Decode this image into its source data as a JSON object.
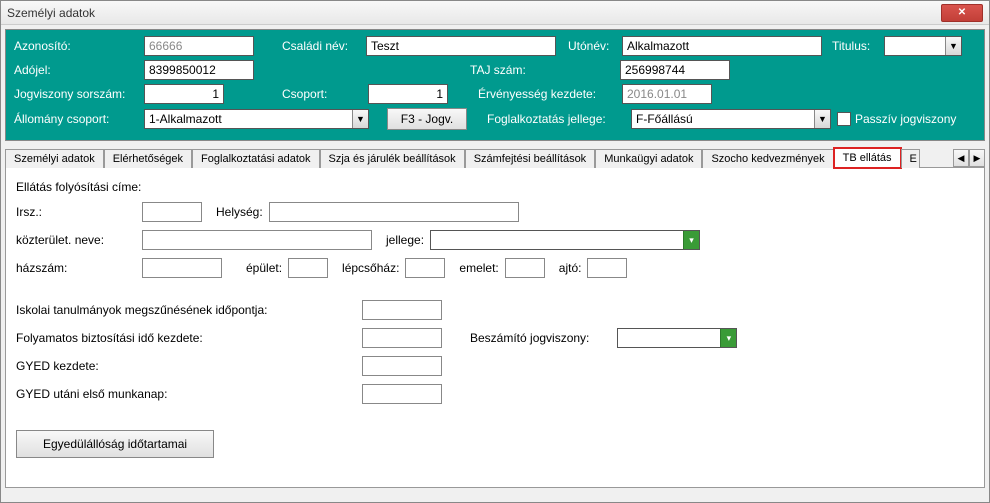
{
  "window": {
    "title": "Személyi adatok"
  },
  "header": {
    "labels": {
      "azonosito": "Azonosító:",
      "csaladinev": "Családi név:",
      "utonev": "Utónév:",
      "titulus": "Titulus:",
      "adojel": "Adójel:",
      "tajszam": "TAJ szám:",
      "jogv_sorszam": "Jogviszony sorszám:",
      "csoport": "Csoport:",
      "erv_kezdete": "Érvényesség kezdete:",
      "allomany_csoport": "Állomány csoport:",
      "f3jogv": "F3 - Jogv.",
      "fogl_jellege": "Foglalkoztatás jellege:",
      "passziv": "Passzív jogviszony"
    },
    "values": {
      "azonosito": "66666",
      "csaladinev": "Teszt",
      "utonev": "Alkalmazott",
      "titulus": "",
      "adojel": "8399850012",
      "tajszam": "256998744",
      "jogv_sorszam": "1",
      "csoport": "1",
      "erv_kezdete": "2016.01.01",
      "allomany_csoport": "1-Alkalmazott",
      "fogl_jellege": "F-Főállású"
    }
  },
  "tabs": {
    "items": [
      "Személyi adatok",
      "Elérhetőségek",
      "Foglalkoztatási adatok",
      "Szja és járulék beállítások",
      "Számfejtési beállítások",
      "Munkaügyi adatok",
      "Szocho kedvezmények",
      "TB ellátás",
      "E"
    ],
    "active_index": 7,
    "highlighted_index": 7
  },
  "tb": {
    "section_title": "Ellátás folyósítási címe:",
    "labels": {
      "irsz": "Irsz.:",
      "helyseg": "Helység:",
      "kozterulet_neve": "közterület. neve:",
      "jellege": "jellege:",
      "hazszam": "házszám:",
      "epulet": "épület:",
      "lepcsohaz": "lépcsőház:",
      "emelet": "emelet:",
      "ajto": "ajtó:",
      "iskolai": "Iskolai tanulmányok megszűnésének időpontja:",
      "folyamatos": "Folyamatos biztosítási idő kezdete:",
      "beszamito": "Beszámító jogviszony:",
      "gyed_kezdete": "GYED kezdete:",
      "gyed_utani": "GYED utáni első munkanap:"
    },
    "button": "Egyedülállóság időtartamai",
    "values": {
      "irsz": "",
      "helyseg": "",
      "kozterulet_neve": "",
      "jellege": "",
      "hazszam": "",
      "epulet": "",
      "lepcsohaz": "",
      "emelet": "",
      "ajto": "",
      "iskolai": "",
      "folyamatos": "",
      "beszamito": "",
      "gyed_kezdete": "",
      "gyed_utani": ""
    }
  }
}
